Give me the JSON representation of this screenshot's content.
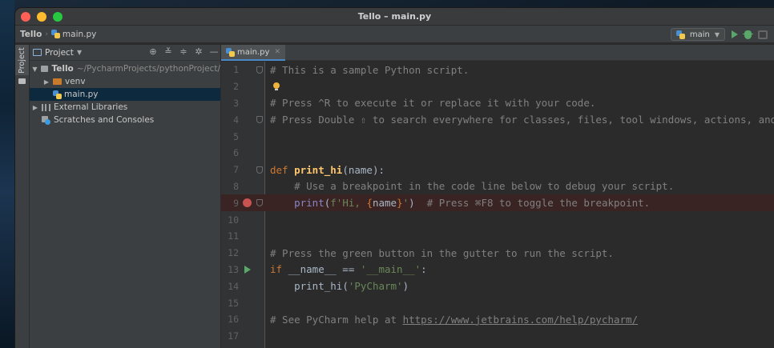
{
  "window": {
    "title": "Tello – main.py"
  },
  "navbar": {
    "project": "Tello",
    "file": "main.py",
    "run_config": "main"
  },
  "project_panel": {
    "strip_label": "Project",
    "header_label": "Project",
    "tree": [
      {
        "label": "Tello",
        "sub": "~/PycharmProjects/pythonProject/",
        "icon": "folder-icon"
      },
      {
        "label": "venv",
        "icon": "folder-icon"
      },
      {
        "label": "main.py",
        "icon": "python-file-icon"
      },
      {
        "label": "External Libraries",
        "icon": "libraries-icon"
      },
      {
        "label": "Scratches and Consoles",
        "icon": "scratches-icon"
      }
    ]
  },
  "editor": {
    "tab": "main.py",
    "lines": {
      "n1": "1",
      "n2": "2",
      "n3": "3",
      "n4": "4",
      "n5": "5",
      "n6": "6",
      "n7": "7",
      "n8": "8",
      "n9": "9",
      "n10": "10",
      "n11": "11",
      "n12": "12",
      "n13": "13",
      "n14": "14",
      "n15": "15",
      "n16": "16",
      "n17": "17"
    },
    "code": {
      "l1": "# This is a sample Python script.",
      "l3": "# Press ^R to execute it or replace it with your code.",
      "l4": "# Press Double ⇧ to search everywhere for classes, files, tool windows, actions, and settings.",
      "l7_kw": "def ",
      "l7_fn": "print_hi",
      "l7_rest": "(name):",
      "l8": "    # Use a breakpoint in the code line below to debug your script.",
      "l9_indent": "    ",
      "l9_call": "print",
      "l9_paren": "(",
      "l9_str1": "f'Hi, ",
      "l9_brace_open": "{",
      "l9_var": "name",
      "l9_brace_close": "}",
      "l9_str2": "'",
      "l9_close": ")",
      "l9_cmt": "  # Press ⌘F8 to toggle the breakpoint.",
      "l12": "# Press the green button in the gutter to run the script.",
      "l13_kw": "if ",
      "l13_name": "__name__ == ",
      "l13_str": "'__main__'",
      "l13_colon": ":",
      "l14_indent": "    ",
      "l14_call": "print_hi(",
      "l14_str": "'PyCharm'",
      "l14_close": ")",
      "l16_text": "# See PyCharm help at ",
      "l16_link": "https://www.jetbrains.com/help/pycharm/"
    }
  },
  "colors": {
    "keyword": "#cc7832",
    "function": "#ffc66d",
    "string": "#6a8759",
    "comment": "#808080",
    "breakpoint": "#c75450",
    "run": "#59a869"
  }
}
